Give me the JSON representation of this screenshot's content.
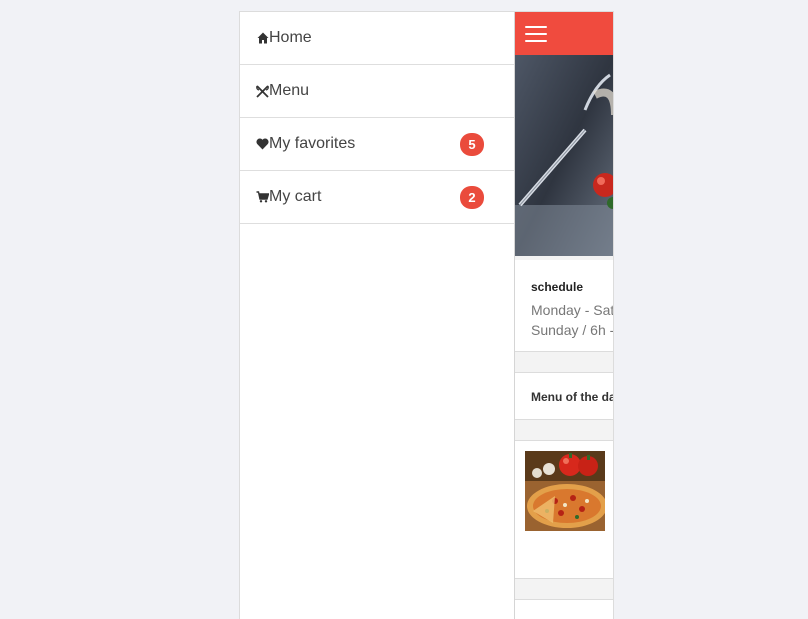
{
  "side_menu": {
    "items": [
      {
        "label": "Home",
        "icon": "home-icon"
      },
      {
        "label": "Menu",
        "icon": "utensils-icon"
      },
      {
        "label": "My favorites",
        "icon": "heart-icon",
        "badge": "5"
      },
      {
        "label": "My cart",
        "icon": "cart-icon",
        "badge": "2"
      }
    ]
  },
  "header": {
    "menu_icon": "hamburger-icon",
    "color": "#f04b3e"
  },
  "schedule": {
    "title": "schedule",
    "line1": "Monday - Sat",
    "line2": "Sunday / 6h -"
  },
  "menu_of_day": {
    "title": "Menu of the da"
  },
  "dish": {
    "image": "pizza-image"
  },
  "colors": {
    "accent": "#f04b3e",
    "badge": "#ea4b3c"
  }
}
